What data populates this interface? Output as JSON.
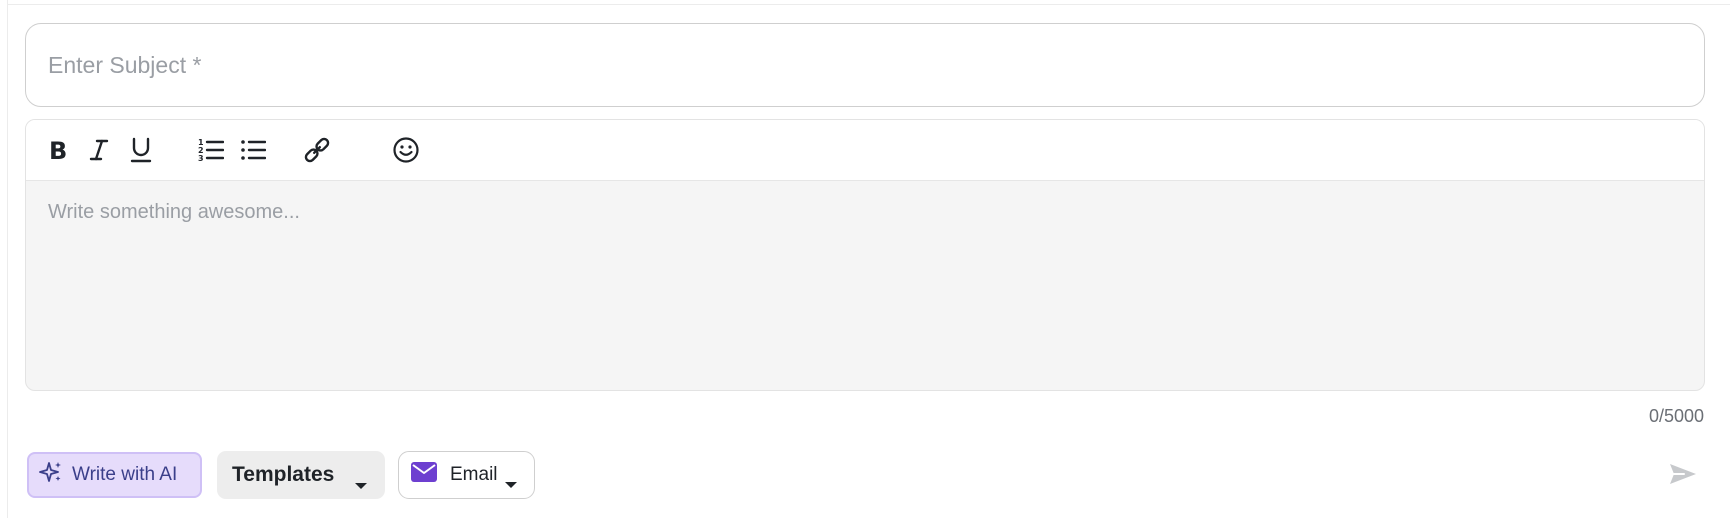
{
  "subject": {
    "placeholder": "Enter Subject *",
    "value": ""
  },
  "toolbar": {
    "icons": [
      "bold-icon",
      "italic-icon",
      "underline-icon",
      "ordered-list-icon",
      "bullet-list-icon",
      "link-icon",
      "emoji-icon"
    ]
  },
  "editor": {
    "placeholder": "Write something awesome..."
  },
  "counter": {
    "text": "0/5000"
  },
  "actions": {
    "ai_label": "Write with AI",
    "templates_label": "Templates",
    "channel_label": "Email"
  },
  "colors": {
    "accent_purple": "#6d3fd0",
    "ai_bg": "#e6dcfb",
    "send_disabled": "#c7c9cc"
  }
}
